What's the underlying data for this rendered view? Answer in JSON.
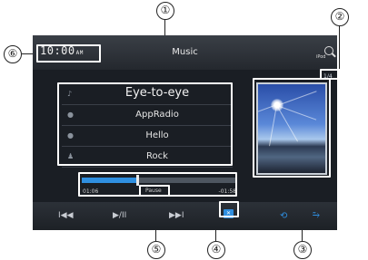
{
  "callouts": {
    "c1": "①",
    "c2": "②",
    "c3": "③",
    "c4": "④",
    "c5": "⑤",
    "c6": "⑥"
  },
  "header": {
    "clock": "10:00",
    "ampm": "AM",
    "title": "Music",
    "source_label": "iPod",
    "search_icon": "search-icon"
  },
  "track_count": "1/4",
  "tags": {
    "title": "Eye-to-eye",
    "artist": "AppRadio",
    "album": "Hello",
    "genre": "Rock"
  },
  "tag_icons": {
    "title": "♪",
    "artist": "👤",
    "album": "●",
    "genre": "♟"
  },
  "playback": {
    "elapsed": "01:06",
    "remaining": "-01:58",
    "status": "Pause",
    "progress_fraction": 0.36
  },
  "controls": {
    "prev": "I◀◀",
    "play_pause": "▶/II",
    "next": "▶▶I",
    "shuffle": "✕",
    "repeat": "⟲",
    "seek": "⥲"
  },
  "colors": {
    "accent": "#2f8fe0",
    "screen_bg": "#1a1e24"
  }
}
